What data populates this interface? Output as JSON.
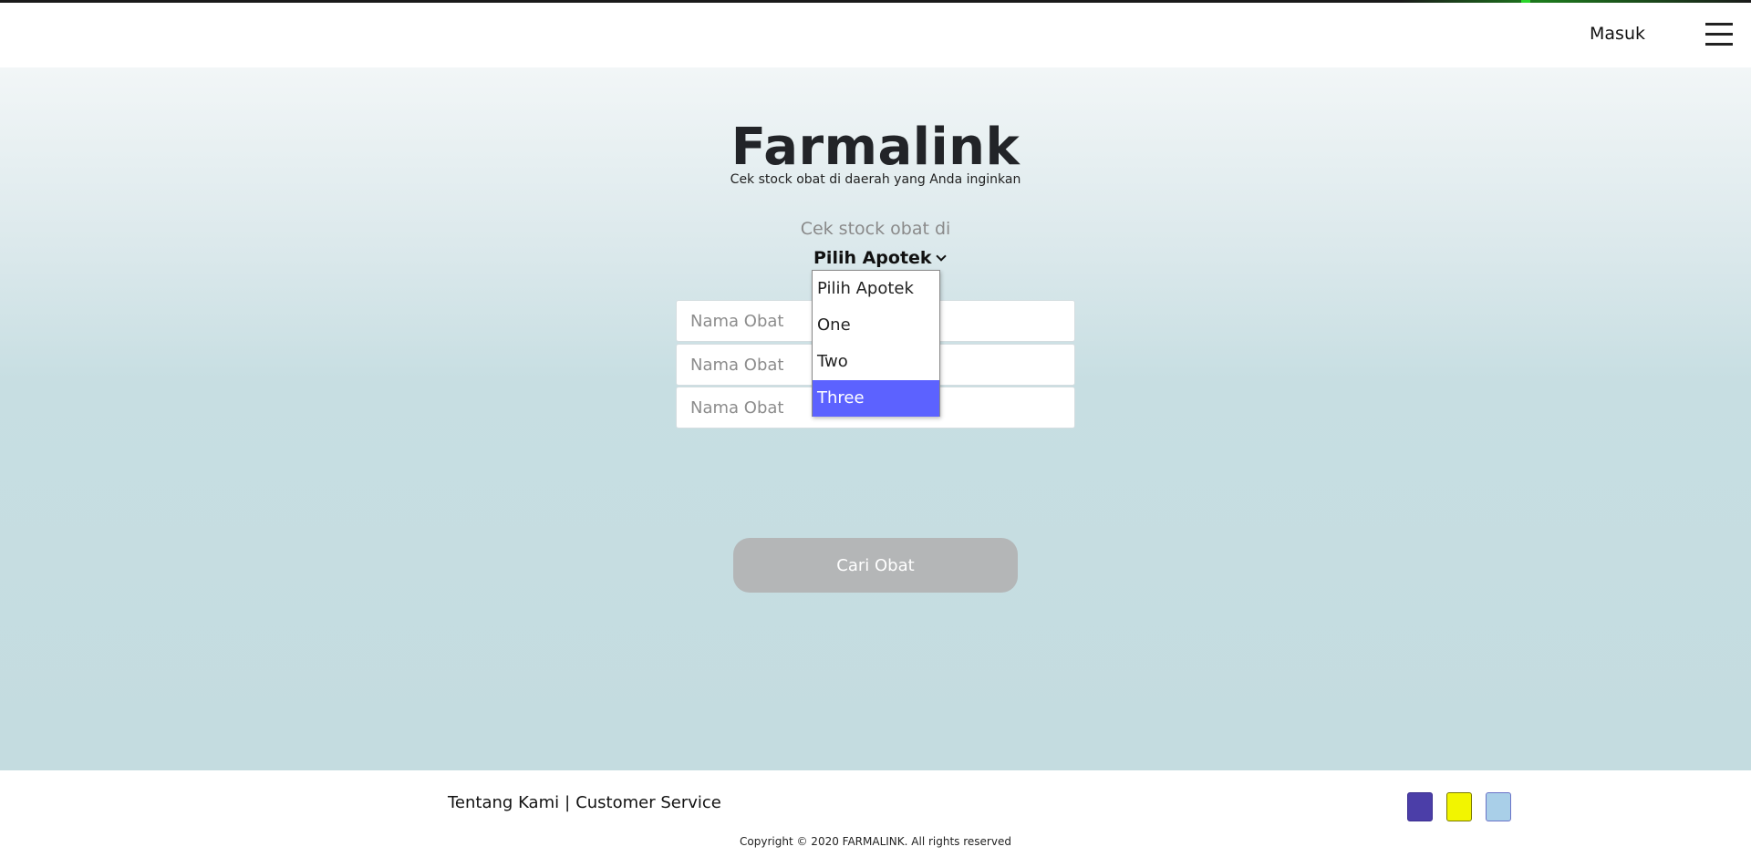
{
  "header": {
    "login_label": "Masuk"
  },
  "hero": {
    "title": "Farmalink",
    "subtitle": "Cek stock obat di daerah yang Anda inginkan",
    "check_label": "Cek stock obat di"
  },
  "pharmacy_select": {
    "selected_label": "Pilih Apotek",
    "options": [
      "Pilih Apotek",
      "One",
      "Two",
      "Three"
    ],
    "highlighted_index": 3
  },
  "medicine_fields": [
    {
      "placeholder": "Nama Obat",
      "value": ""
    },
    {
      "placeholder": "Nama Obat",
      "value": ""
    },
    {
      "placeholder": "Nama Obat",
      "value": ""
    }
  ],
  "search_button": {
    "label": "Cari Obat"
  },
  "footer": {
    "about_label": "Tentang Kami",
    "separator": "|",
    "service_label": "Customer Service",
    "copyright": "Copyright © 2020 FARMALINK. All rights reserved",
    "swatches": [
      {
        "color": "#4b3ea8",
        "border": "#3b2f90"
      },
      {
        "color": "#f2f500",
        "border": "#7a7a00"
      },
      {
        "color": "#a9cfe8",
        "border": "#6a74c8"
      }
    ]
  },
  "colors": {
    "accent": "#5c62ff",
    "button_disabled": "#b4b6b7",
    "title": "#222428"
  },
  "icons": {
    "menu": "hamburger-icon",
    "select": "chevron-down-icon"
  }
}
